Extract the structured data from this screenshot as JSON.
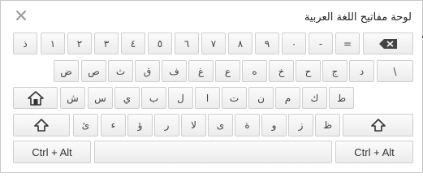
{
  "header": {
    "title": "لوحة مفاتيح اللغة العربية"
  },
  "icons": {
    "close": "close-icon",
    "backspace": "backspace-icon",
    "capslock": "capslock-home-icon",
    "shift": "shift-arrow-icon"
  },
  "row1": [
    "ذ",
    "١",
    "٢",
    "٣",
    "٤",
    "٥",
    "٦",
    "٧",
    "٨",
    "٩",
    "٠",
    "-",
    "="
  ],
  "row2": [
    "ض",
    "ص",
    "ث",
    "ق",
    "ف",
    "غ",
    "ع",
    "ه",
    "خ",
    "ح",
    "ج",
    "د",
    "\\"
  ],
  "row3": [
    "ش",
    "س",
    "ي",
    "ب",
    "ل",
    "ا",
    "ت",
    "ن",
    "م",
    "ك",
    "ط"
  ],
  "row4": [
    "ئ",
    "ء",
    "ؤ",
    "ر",
    "لا",
    "ى",
    "ة",
    "و",
    "ز",
    "ظ"
  ],
  "bottom": {
    "ctrl_alt_left": "Ctrl + Alt",
    "ctrl_alt_right": "Ctrl + Alt"
  }
}
